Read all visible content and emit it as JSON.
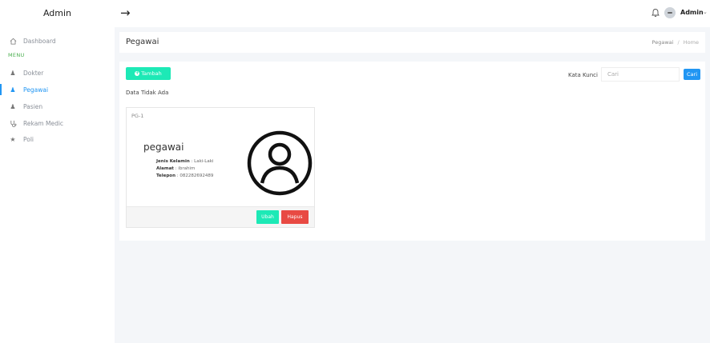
{
  "app": {
    "brand": "Admin"
  },
  "topbar": {
    "toggle_icon": "arrow-right-icon",
    "notification_icon": "bell-icon",
    "user": {
      "name": "Admin",
      "caret": "⌄"
    }
  },
  "sidebar": {
    "dashboard": {
      "label": "Dashboard",
      "icon": "home-icon"
    },
    "menu_label": "MENU",
    "items": [
      {
        "label": "Dokter",
        "icon": "user-md-icon"
      },
      {
        "label": "Pegawai",
        "icon": "user-icon",
        "active": true
      },
      {
        "label": "Pasien",
        "icon": "users-icon"
      },
      {
        "label": "Rekam Medic",
        "icon": "stethoscope-icon"
      },
      {
        "label": "Poli",
        "icon": "star-icon"
      }
    ]
  },
  "header": {
    "title": "Pegawai",
    "breadcrumb": [
      "Pegawai",
      "Home"
    ],
    "breadcrumb_sep": "/"
  },
  "toolbar": {
    "add_label": "Tambah",
    "no_data": "Data Tidak Ada",
    "search_label": "Kata Kunci",
    "search_placeholder": "Cari",
    "search_button": "Cari"
  },
  "employee_card": {
    "code": "PG-1",
    "name": "pegawai",
    "fields": [
      {
        "label": "Jenis Kelamin",
        "value": "Laki-Laki"
      },
      {
        "label": "Alamat",
        "value": "ibrahim"
      },
      {
        "label": "Telepon",
        "value": "082282692489"
      }
    ],
    "edit_label": "Ubah",
    "delete_label": "Hapus"
  },
  "colors": {
    "accent": "#2196f3",
    "success": "#1de9b6",
    "danger": "#e84a43",
    "menu_label": "#4caf50"
  }
}
